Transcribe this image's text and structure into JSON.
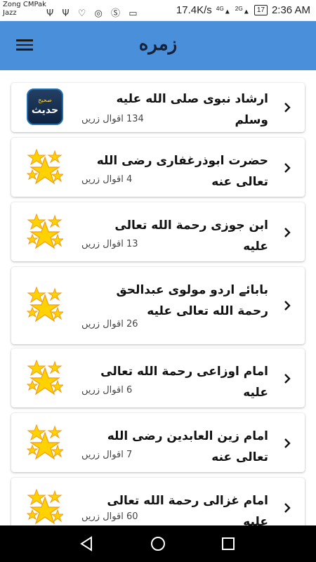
{
  "status_bar": {
    "carrier_line1": "Zong CMPak",
    "carrier_line2": "Jazz",
    "left_icons": [
      "usb-icon",
      "usb-icon",
      "heart-monitor-icon",
      "whatsapp-icon",
      "skype-icon",
      "sim-icon"
    ],
    "speed": "17.4K/s",
    "network_4g": "4G",
    "network_2g": "2G",
    "battery": "17",
    "time": "2:36 AM"
  },
  "app_bar": {
    "title": "زمره",
    "menu_icon": "hamburger-menu-icon"
  },
  "items": [
    {
      "title": "ارشاد نبوی صلی الله علیه وسلم",
      "count": "134 اقوال زریں",
      "icon": "sahih-hadith-badge",
      "badge_small": "صحیح",
      "badge_big": "حدیث"
    },
    {
      "title": "حضرت ابوذرغفاری رضی الله تعالی عنه",
      "count": "4 اقوال زریں",
      "icon": "stars-icon"
    },
    {
      "title": "ابن جوزی رحمة الله تعالی علیه",
      "count": "13 اقوال زریں",
      "icon": "stars-icon"
    },
    {
      "title": "بابائے اردو مولوی عبدالحق رحمة الله تعالی علیه",
      "count": "26 اقوال زریں",
      "icon": "stars-icon"
    },
    {
      "title": "امام اوزاعی رحمة الله تعالی علیه",
      "count": "6 اقوال زریں",
      "icon": "stars-icon"
    },
    {
      "title": "امام زین العابدین رضی الله تعالی عنه",
      "count": "7 اقوال زریں",
      "icon": "stars-icon"
    },
    {
      "title": "امام غزالی رحمة الله تعالی علیه",
      "count": "60 اقوال زریں",
      "icon": "stars-icon"
    }
  ],
  "nav_bar": {
    "back": "back-triangle-icon",
    "home": "home-circle-icon",
    "recents": "recents-square-icon"
  },
  "colors": {
    "app_bar": "#4a8fd9",
    "star_yellow": "#ffd200",
    "star_orange": "#f39c12"
  }
}
